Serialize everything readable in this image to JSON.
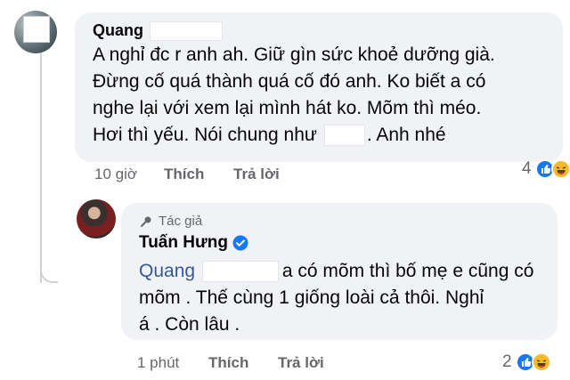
{
  "comment": {
    "author_name": "Quang",
    "lines": [
      "A nghỉ đc r anh ah. Giữ gìn sức khoẻ dưỡng già.",
      "Đừng cố quá thành quá cố đó anh. Ko biết a có",
      "nghe lại với xem lại mình hát ko. Mõm thì méo.",
      "Hơi thì yếu. Nói chung như",
      ". Anh nhé"
    ],
    "time": "10 giờ",
    "like_label": "Thích",
    "reply_label": "Trả lời",
    "reaction_count": "4"
  },
  "reply": {
    "author_tag": "Tác giả",
    "author_name": "Tuấn Hưng",
    "mention": "Quang",
    "lines": [
      "a có mõm thì bố mẹ e cũng có",
      "mõm . Thế cùng 1 giống loài cả  thôi. Nghỉ",
      "á . Còn lâu ."
    ],
    "time": "1 phút",
    "like_label": "Thích",
    "reply_label": "Trả lời",
    "reaction_count": "2"
  },
  "colors": {
    "bubble": "#f0f2f5",
    "meta": "#65676b",
    "mention": "#385898",
    "like": "#1877f2",
    "verified": "#1877f2"
  }
}
